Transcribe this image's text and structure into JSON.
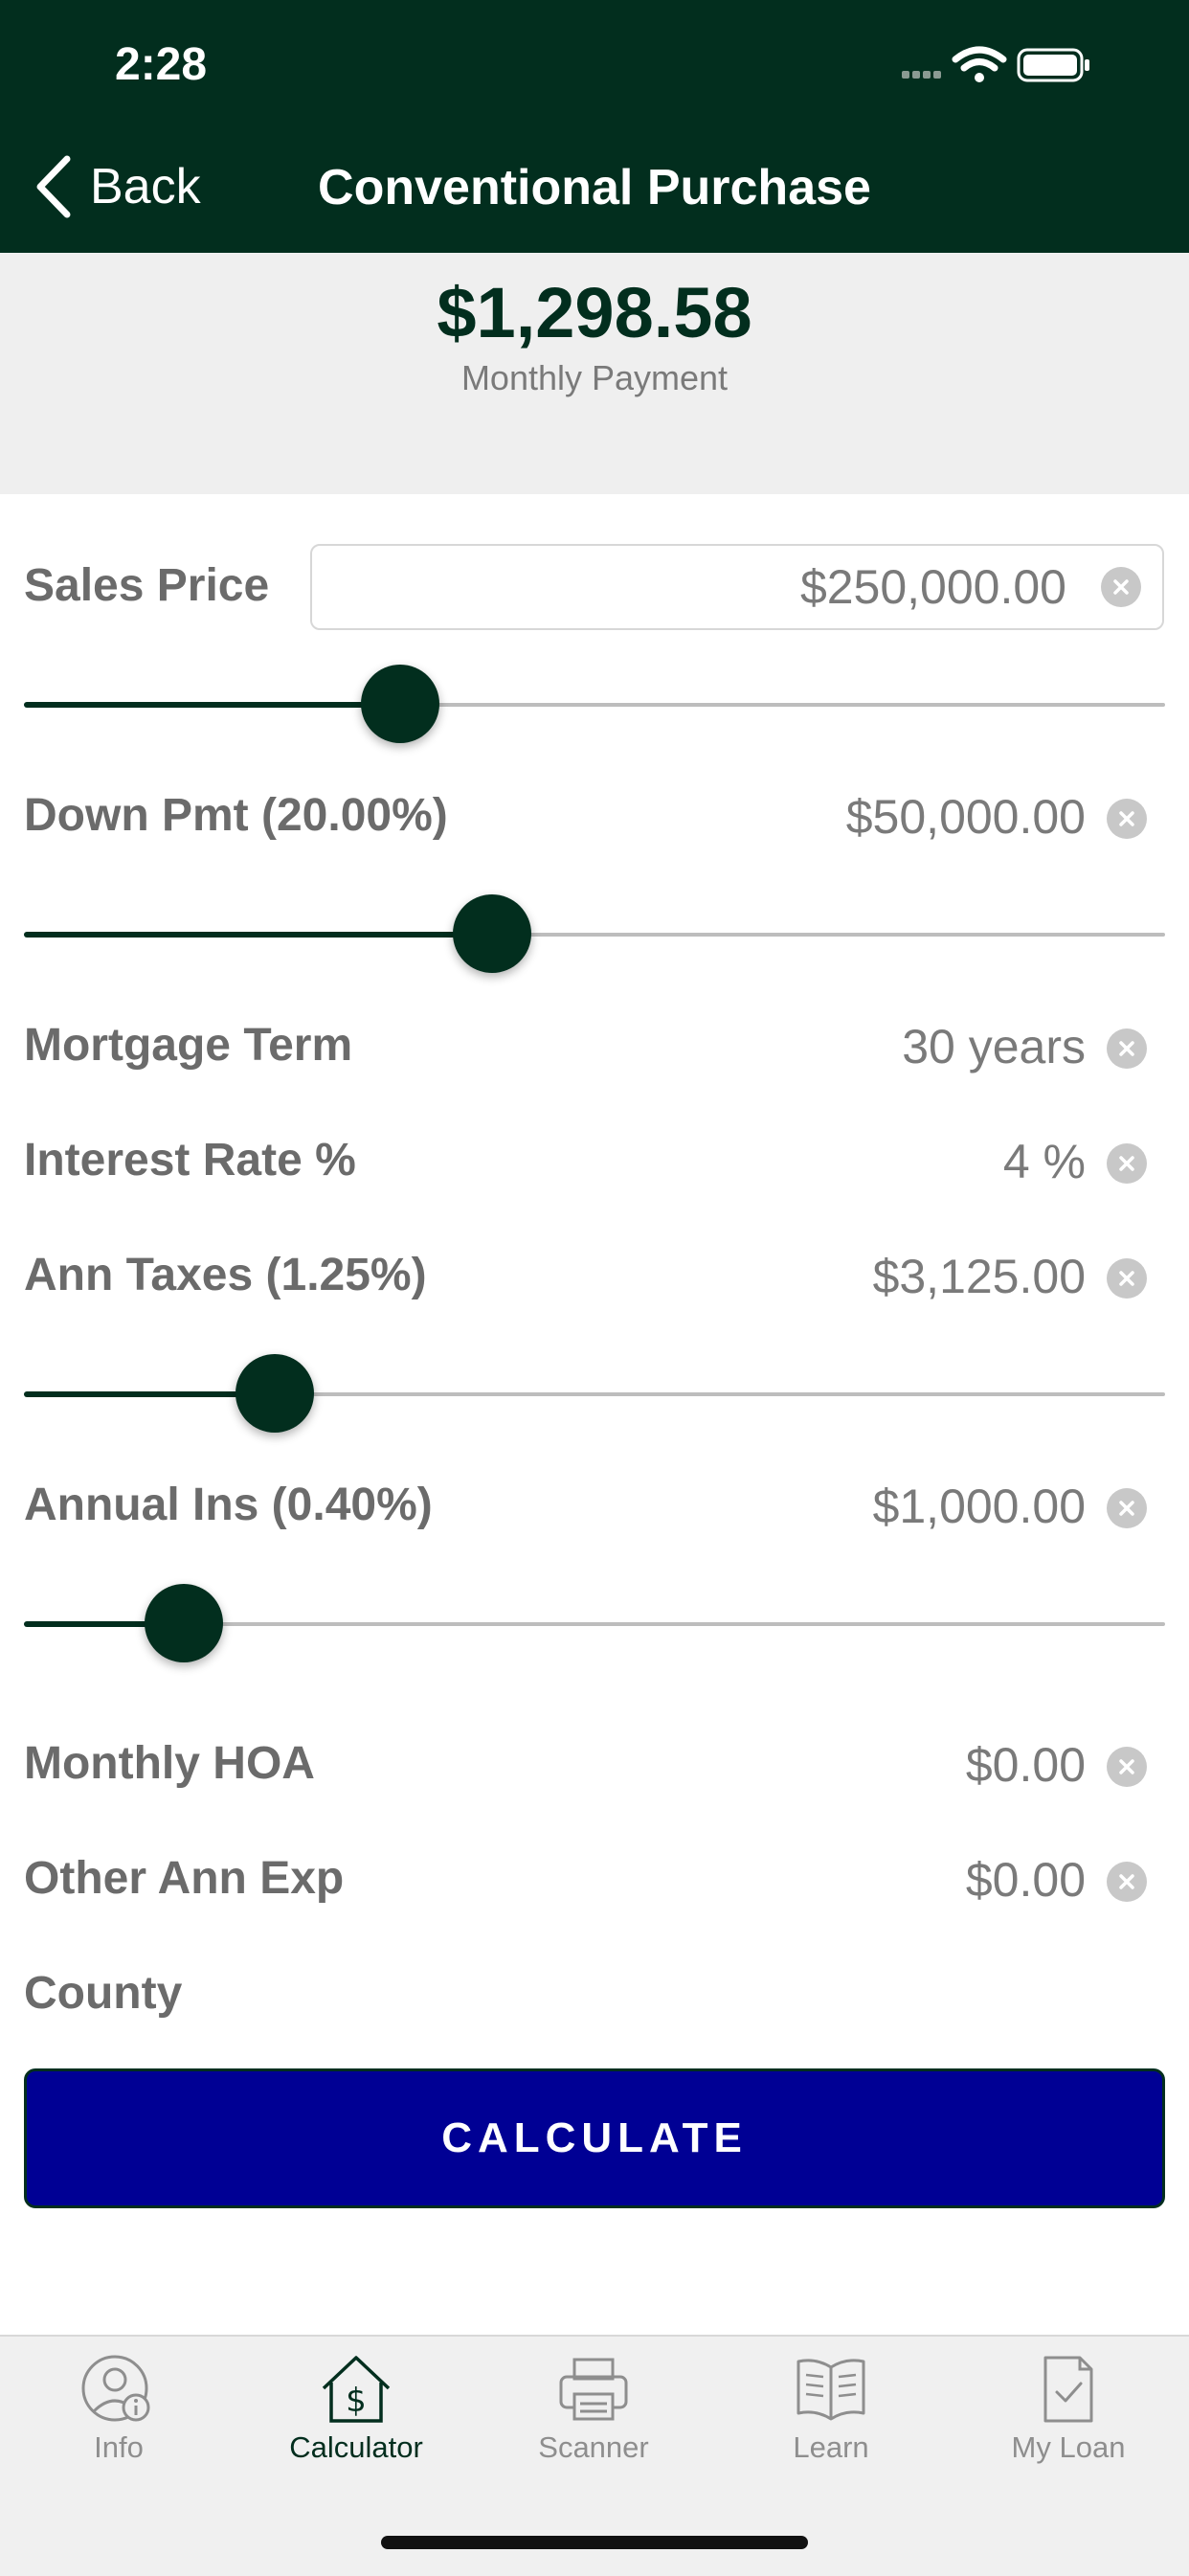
{
  "status_bar": {
    "time": "2:28"
  },
  "nav": {
    "back_label": "Back",
    "title": "Conventional Purchase"
  },
  "summary": {
    "amount": "$1,298.58",
    "label": "Monthly Payment"
  },
  "fields": {
    "sales_price": {
      "label": "Sales Price",
      "value": "$250,000.00",
      "slider_fraction": 0.33
    },
    "down_pmt": {
      "label": "Down Pmt (20.00%)",
      "value": "$50,000.00",
      "slider_fraction": 0.41
    },
    "mortgage_term": {
      "label": "Mortgage Term",
      "value": "30 years"
    },
    "interest_rate": {
      "label": "Interest Rate %",
      "value": "4 %"
    },
    "ann_taxes": {
      "label": "Ann Taxes (1.25%)",
      "value": "$3,125.00",
      "slider_fraction": 0.22
    },
    "annual_ins": {
      "label": "Annual Ins (0.40%)",
      "value": "$1,000.00",
      "slider_fraction": 0.14
    },
    "monthly_hoa": {
      "label": "Monthly HOA",
      "value": "$0.00"
    },
    "other_ann_exp": {
      "label": "Other Ann Exp",
      "value": "$0.00"
    },
    "county": {
      "label": "County"
    }
  },
  "calculate_label": "CALCULATE",
  "tabs": [
    {
      "label": "Info",
      "icon": "info-person-icon"
    },
    {
      "label": "Calculator",
      "icon": "calculator-house-icon",
      "active": true
    },
    {
      "label": "Scanner",
      "icon": "printer-icon"
    },
    {
      "label": "Learn",
      "icon": "book-icon"
    },
    {
      "label": "My Loan",
      "icon": "document-check-icon"
    }
  ],
  "colors": {
    "primary": "#022e1e",
    "button": "#000094",
    "label": "#6b6b6b"
  }
}
